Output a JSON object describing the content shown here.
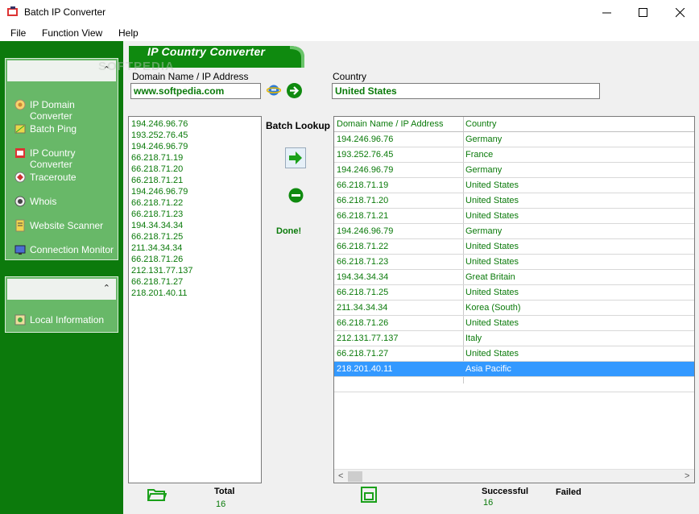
{
  "window": {
    "title": "Batch IP Converter"
  },
  "menu": [
    "File",
    "Function View",
    "Help"
  ],
  "sidebar": {
    "tools": [
      {
        "label": "IP Domain Converter",
        "icon": "ip-domain-icon"
      },
      {
        "label": "Batch Ping",
        "icon": "batch-ping-icon"
      },
      {
        "label": "IP Country Converter",
        "icon": "ip-country-icon"
      },
      {
        "label": "Traceroute",
        "icon": "traceroute-icon"
      },
      {
        "label": "Whois",
        "icon": "whois-icon"
      },
      {
        "label": "Website Scanner",
        "icon": "website-scanner-icon"
      },
      {
        "label": "Connection Monitor",
        "icon": "connection-monitor-icon"
      }
    ],
    "local": [
      {
        "label": "Local Information",
        "icon": "local-info-icon"
      }
    ]
  },
  "banner": {
    "title": "IP Country Converter",
    "watermark": "SOFTPEDIA"
  },
  "lookup": {
    "domain_label": "Domain Name / IP Address",
    "domain_value": "www.softpedia.com",
    "country_label": "Country",
    "country_value": "United States"
  },
  "batch": {
    "label": "Batch Lookup",
    "status": "Done!",
    "input_list": [
      "194.246.96.76",
      "193.252.76.45",
      "194.246.96.79",
      "66.218.71.19",
      "66.218.71.20",
      "66.218.71.21",
      "194.246.96.79",
      "66.218.71.22",
      "66.218.71.23",
      "194.34.34.34",
      "66.218.71.25",
      "211.34.34.34",
      "66.218.71.26",
      "212.131.77.137",
      "66.218.71.27",
      "218.201.40.11"
    ]
  },
  "results": {
    "columns": [
      "Domain Name / IP Address",
      "Country"
    ],
    "rows": [
      [
        "194.246.96.76",
        "Germany"
      ],
      [
        "193.252.76.45",
        "France"
      ],
      [
        "194.246.96.79",
        "Germany"
      ],
      [
        "66.218.71.19",
        "United States"
      ],
      [
        "66.218.71.20",
        "United States"
      ],
      [
        "66.218.71.21",
        "United States"
      ],
      [
        "194.246.96.79",
        "Germany"
      ],
      [
        "66.218.71.22",
        "United States"
      ],
      [
        "66.218.71.23",
        "United States"
      ],
      [
        "194.34.34.34",
        "Great Britain"
      ],
      [
        "66.218.71.25",
        "United States"
      ],
      [
        "211.34.34.34",
        "Korea (South)"
      ],
      [
        "66.218.71.26",
        "United States"
      ],
      [
        "212.131.77.137",
        "Italy"
      ],
      [
        "66.218.71.27",
        "United States"
      ],
      [
        "218.201.40.11",
        "Asia Pacific"
      ]
    ],
    "selected_row": 15
  },
  "footer": {
    "total_label": "Total",
    "total_value": "16",
    "successful_label": "Successful",
    "successful_value": "16",
    "failed_label": "Failed"
  },
  "colors": {
    "sidebar": "#0c7a0c",
    "accent_text": "#0a7a0a",
    "selection": "#3399ff"
  }
}
